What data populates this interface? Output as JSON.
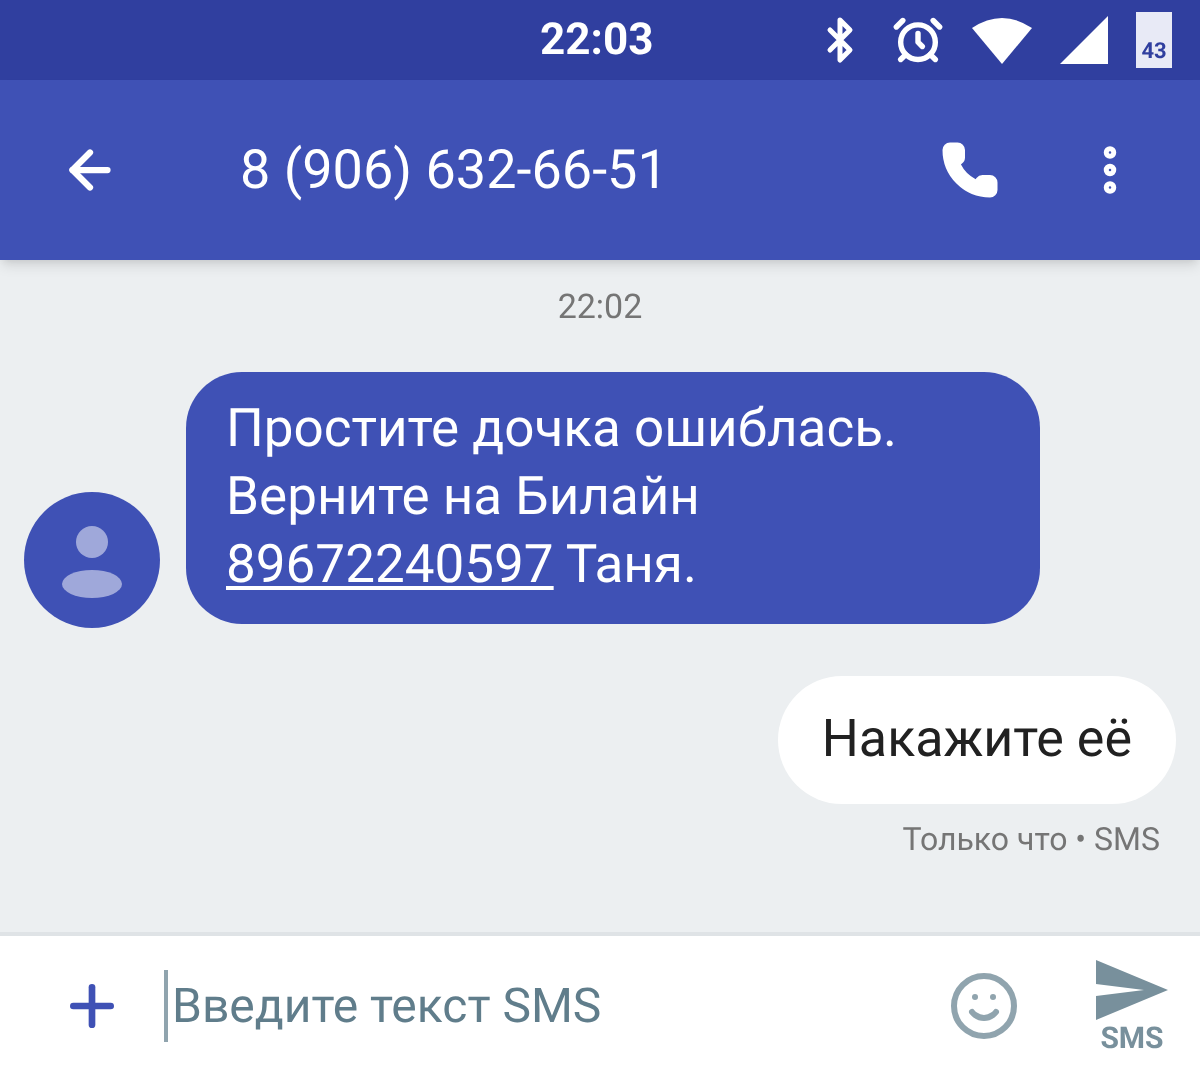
{
  "status_bar": {
    "time": "22:03",
    "battery": "43"
  },
  "header": {
    "title": "8 (906) 632-66-51"
  },
  "conversation": {
    "timestamp": "22:02",
    "messages": [
      {
        "kind": "incoming",
        "text": "Простите дочка ошиблась. Верните на Билайн",
        "link": "89672240597",
        "text_after": "Таня."
      },
      {
        "kind": "outgoing",
        "text": "Накажите её",
        "meta": "Только что • SMS"
      }
    ]
  },
  "composer": {
    "placeholder": "Введите текст SMS",
    "send_label": "SMS"
  }
}
